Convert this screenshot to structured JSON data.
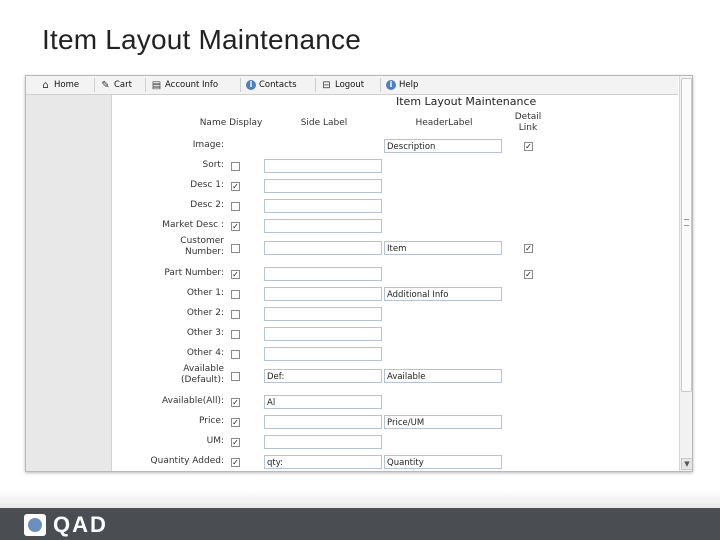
{
  "slide": {
    "title": "Item Layout Maintenance"
  },
  "nav": [
    {
      "label": "Home",
      "icon": "home-icon"
    },
    {
      "label": "Cart",
      "icon": "cart-icon"
    },
    {
      "label": "Account Info",
      "icon": "account-icon"
    },
    {
      "label": "Contacts",
      "icon": "info-icon"
    },
    {
      "label": "Logout",
      "icon": "logout-icon"
    },
    {
      "label": "Help",
      "icon": "info-icon"
    }
  ],
  "form": {
    "title": "Item Layout Maintenance",
    "headers": {
      "name": "Name Display",
      "side": "Side Label",
      "header": "HeaderLabel",
      "detail": "Detail Link"
    },
    "rows": [
      {
        "label": "Image:",
        "display": null,
        "side": null,
        "header": "Description",
        "detail": true
      },
      {
        "label": "Sort:",
        "display": false,
        "side": "",
        "header": null,
        "detail": null
      },
      {
        "label": "Desc 1:",
        "display": true,
        "side": "",
        "header": null,
        "detail": null
      },
      {
        "label": "Desc 2:",
        "display": false,
        "side": "",
        "header": null,
        "detail": null
      },
      {
        "label": "Market Desc :",
        "display": true,
        "side": "",
        "header": null,
        "detail": null
      },
      {
        "label": "Customer Number:",
        "display": false,
        "side": "",
        "header": "Item",
        "detail": true
      },
      {
        "label": "Part Number:",
        "display": true,
        "side": "",
        "header": null,
        "detail": true
      },
      {
        "label": "Other 1:",
        "display": false,
        "side": "",
        "header": "Additional Info",
        "detail": null
      },
      {
        "label": "Other 2:",
        "display": false,
        "side": "",
        "header": null,
        "detail": null
      },
      {
        "label": "Other 3:",
        "display": false,
        "side": "",
        "header": null,
        "detail": null
      },
      {
        "label": "Other 4:",
        "display": false,
        "side": "",
        "header": null,
        "detail": null
      },
      {
        "label": "Available (Default):",
        "display": false,
        "side": "Def:",
        "header": "Available",
        "detail": null
      },
      {
        "label": "Available(All):",
        "display": true,
        "side": "Al",
        "header": null,
        "detail": null
      },
      {
        "label": "Price:",
        "display": true,
        "side": "",
        "header": "Price/UM",
        "detail": null
      },
      {
        "label": "UM:",
        "display": true,
        "side": "",
        "header": null,
        "detail": null
      },
      {
        "label": "Quantity Added:",
        "display": true,
        "side": "qty:",
        "header": "Quantity",
        "detail": null
      }
    ]
  },
  "footer": {
    "logo": "QAD"
  },
  "colors": {
    "footer": "#4a4d52",
    "panel": "#e8e8e8",
    "accent": "#4f7fbf"
  }
}
